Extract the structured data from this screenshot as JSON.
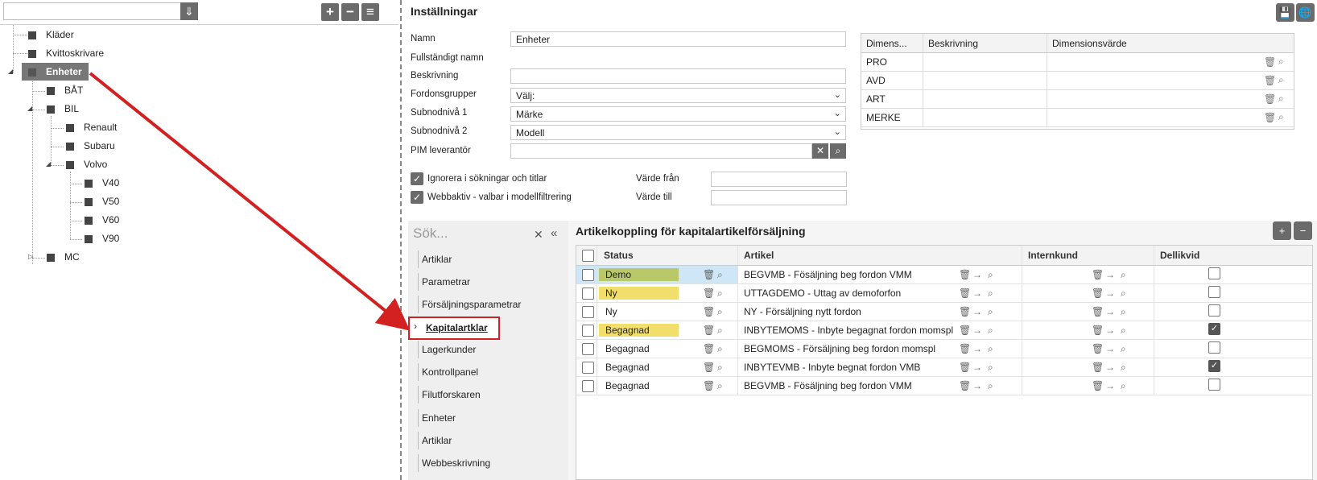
{
  "tree": {
    "combo_value": "",
    "nodes": [
      {
        "label": "Kläder"
      },
      {
        "label": "Kvittoskrivare"
      },
      {
        "label": "Enheter"
      },
      {
        "label": "BÅT"
      },
      {
        "label": "BIL"
      },
      {
        "label": "Renault"
      },
      {
        "label": "Subaru"
      },
      {
        "label": "Volvo"
      },
      {
        "label": "V40"
      },
      {
        "label": "V50"
      },
      {
        "label": "V60"
      },
      {
        "label": "V90"
      },
      {
        "label": "MC"
      }
    ],
    "buttons": {
      "add": "+",
      "remove": "−",
      "menu": "≡"
    }
  },
  "settings": {
    "title": "Inställningar",
    "fields": {
      "namn_label": "Namn",
      "namn_value": "Enheter",
      "fullstandigt_label": "Fullständigt namn",
      "beskrivning_label": "Beskrivning",
      "beskrivning_value": "",
      "fordonsgrupper_label": "Fordonsgrupper",
      "fordonsgrupper_value": "Välj:",
      "subnod1_label": "Subnodnivå 1",
      "subnod1_value": "Märke",
      "subnod2_label": "Subnodnivå 2",
      "subnod2_value": "Modell",
      "pim_label": "PIM leverantör",
      "pim_value": ""
    },
    "checks": {
      "ignorera_label": "Ignorera i sökningar och titlar",
      "ignorera_checked": true,
      "webbaktiv_label": "Webbaktiv - valbar i modellfiltrering",
      "webbaktiv_checked": true
    },
    "range": {
      "fran_label": "Värde från",
      "fran_value": "",
      "till_label": "Värde till",
      "till_value": ""
    }
  },
  "dimensions": {
    "headers": [
      "Dimens...",
      "Beskrivning",
      "Dimensionsvärde"
    ],
    "rows": [
      {
        "dim": "PRO",
        "desc": "",
        "value": ""
      },
      {
        "dim": "AVD",
        "desc": "",
        "value": ""
      },
      {
        "dim": "ART",
        "desc": "",
        "value": ""
      },
      {
        "dim": "MERKE",
        "desc": "",
        "value": ""
      }
    ]
  },
  "nav": {
    "search_placeholder": "Sök...",
    "items": [
      {
        "label": "Artiklar"
      },
      {
        "label": "Parametrar"
      },
      {
        "label": "Försäljningsparametrar"
      },
      {
        "label": "Kapitalartklar"
      },
      {
        "label": "Lagerkunder"
      },
      {
        "label": "Kontrollpanel"
      },
      {
        "label": "Filutforskaren"
      },
      {
        "label": "Enheter"
      },
      {
        "label": "Artiklar"
      },
      {
        "label": "Webbeskrivning"
      }
    ],
    "active_index": 3
  },
  "grid": {
    "title": "Artikelkoppling för kapitalartikelförsäljning",
    "headers": {
      "status": "Status",
      "artikel": "Artikel",
      "internkund": "Internkund",
      "dellikvid": "Dellikvid"
    },
    "rows": [
      {
        "status": "Demo",
        "status_color": "#b9c96a",
        "artikel": "BEGVMB - Fösäljning beg fordon VMM",
        "dellikvid": false
      },
      {
        "status": "Ny",
        "status_color": "#f2df6b",
        "artikel": "UTTAGDEMO - Uttag av demoforfon",
        "dellikvid": false
      },
      {
        "status": "Ny",
        "status_color": "",
        "artikel": "NY - Försäljning nytt fordon",
        "dellikvid": false
      },
      {
        "status": "Begagnad",
        "status_color": "#f2df6b",
        "artikel": "INBYTEMOMS - Inbyte begagnat fordon momspl",
        "dellikvid": true
      },
      {
        "status": "Begagnad",
        "status_color": "",
        "artikel": "BEGMOMS - Försäljning beg fordon momspl",
        "dellikvid": false
      },
      {
        "status": "Begagnad",
        "status_color": "",
        "artikel": "INBYTEVMB - Inbyte begnat fordon VMB",
        "dellikvid": true
      },
      {
        "status": "Begagnad",
        "status_color": "",
        "artikel": "BEGVMB - Fösäljning beg fordon VMM",
        "dellikvid": false
      }
    ]
  },
  "colors": {
    "annotation": "#d32020",
    "selected_row": "#cfe6f7",
    "button_gray": "#6b6b6b"
  }
}
